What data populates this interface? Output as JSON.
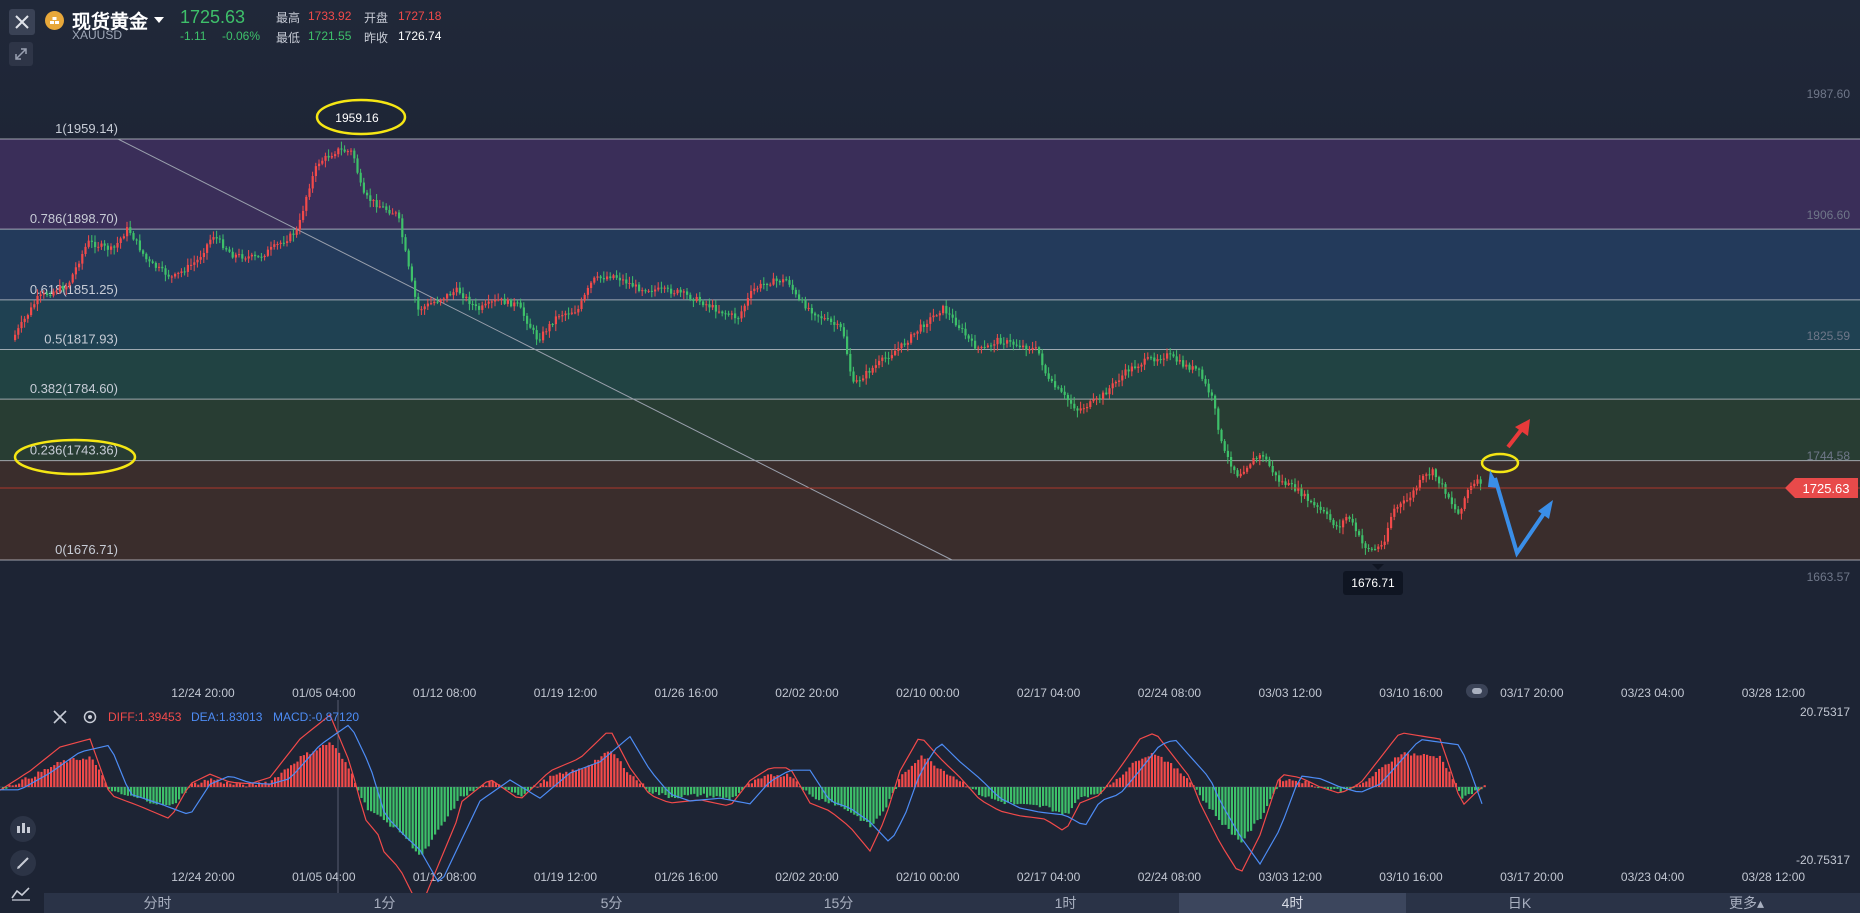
{
  "header": {
    "title": "现货黄金",
    "symbol": "XAUUSD",
    "price": "1725.63",
    "change": "-1.11",
    "change_pct": "-0.06%",
    "high_label": "最高",
    "high_value": "1733.92",
    "open_label": "开盘",
    "open_value": "1727.18",
    "low_label": "最低",
    "low_value": "1721.55",
    "prev_close_label": "昨收",
    "prev_close_value": "1726.74"
  },
  "fib_levels": [
    {
      "label": "1(1959.14)",
      "price": 1959.14,
      "fill": "#3a2e59"
    },
    {
      "label": "0.786(1898.70)",
      "price": 1898.7,
      "fill": "#233a5b"
    },
    {
      "label": "0.618(1851.25)",
      "price": 1851.25,
      "fill": "#1f4152"
    },
    {
      "label": "0.5(1817.93)",
      "price": 1817.93,
      "fill": "#214343"
    },
    {
      "label": "0.382(1784.60)",
      "price": 1784.6,
      "fill": "#283d33"
    },
    {
      "label": "0.236(1743.36)",
      "price": 1743.36,
      "fill": "#3a2d2c"
    },
    {
      "label": "0(1676.71)",
      "price": 1676.71,
      "fill": null
    }
  ],
  "price_axis": [
    "1987.60",
    "1906.60",
    "1825.59",
    "1744.58",
    "1663.57"
  ],
  "current_price_tag": "1725.63",
  "annotations": {
    "high_marker": "1959.16",
    "low_marker": "1676.71"
  },
  "time_axis": [
    "12/24 20:00",
    "01/05 04:00",
    "01/12 08:00",
    "01/19 12:00",
    "01/26 16:00",
    "02/02 20:00",
    "02/10 00:00",
    "02/17 04:00",
    "02/24 08:00",
    "03/03 12:00",
    "03/10 16:00",
    "03/17 20:00",
    "03/23 04:00",
    "03/28 12:00"
  ],
  "macd": {
    "diff": "DIFF:1.39453",
    "dea": "DEA:1.83013",
    "macd": "MACD:-0.87120",
    "axis_top": "20.75317",
    "axis_bottom": "-20.75317"
  },
  "tabs": [
    {
      "label": "分时",
      "active": false
    },
    {
      "label": "1分",
      "active": false
    },
    {
      "label": "5分",
      "active": false
    },
    {
      "label": "15分",
      "active": false
    },
    {
      "label": "1时",
      "active": false
    },
    {
      "label": "4时",
      "active": true
    },
    {
      "label": "日K",
      "active": false
    },
    {
      "label": "更多▴",
      "active": false
    }
  ],
  "colors": {
    "up": "#f24a4a",
    "down": "#3ec06a",
    "diff_line": "#f24a4a",
    "dea_line": "#4d8cf5",
    "highlight": "#f5e614",
    "arrow_up": "#e83a3a",
    "arrow_blue": "#3a8ee8"
  }
}
